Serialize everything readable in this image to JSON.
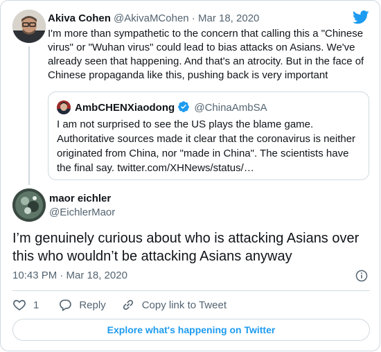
{
  "parent_tweet": {
    "author_name": "Akiva Cohen",
    "author_handle": "@AkivaMCohen",
    "separator": " · ",
    "date": "Mar 18, 2020",
    "text": "I'm more than sympathetic to the concern that calling this a \"Chinese virus\" or \"Wuhan virus\" could lead to bias attacks on Asians. We've already seen that happening. And that's an atrocity. But in the face of Chinese propaganda like this, pushing back is very important",
    "quote": {
      "author_name": "AmbCHENXiaodong",
      "author_handle": "@ChinaAmbSA",
      "verified": true,
      "text": "I am not surprised to see the US plays the blame game. Authoritative sources made it clear that the coronavirus is neither originated from China, nor \"made in China\". The scientists have the final say. twitter.com/XHNews/status/…"
    }
  },
  "main_tweet": {
    "author_name": "maor eichler",
    "author_handle": "@EichlerMaor",
    "text": "I’m genuinely curious about who is attacking Asians over this who wouldn’t be attacking Asians anyway",
    "timestamp": "10:43 PM · Mar 18, 2020",
    "like_count": "1",
    "reply_label": "Reply",
    "copy_link_label": "Copy link to Tweet"
  },
  "explore_label": "Explore what's happening on Twitter",
  "icons": {
    "brand": "twitter-bird-icon",
    "info": "info-icon",
    "like": "heart-icon",
    "reply": "reply-bubble-icon",
    "copy": "link-icon",
    "verified": "verified-badge-icon"
  },
  "colors": {
    "accent": "#1d9bf0",
    "text": "#0f1419",
    "muted": "#536471",
    "border": "#cfd9de"
  }
}
